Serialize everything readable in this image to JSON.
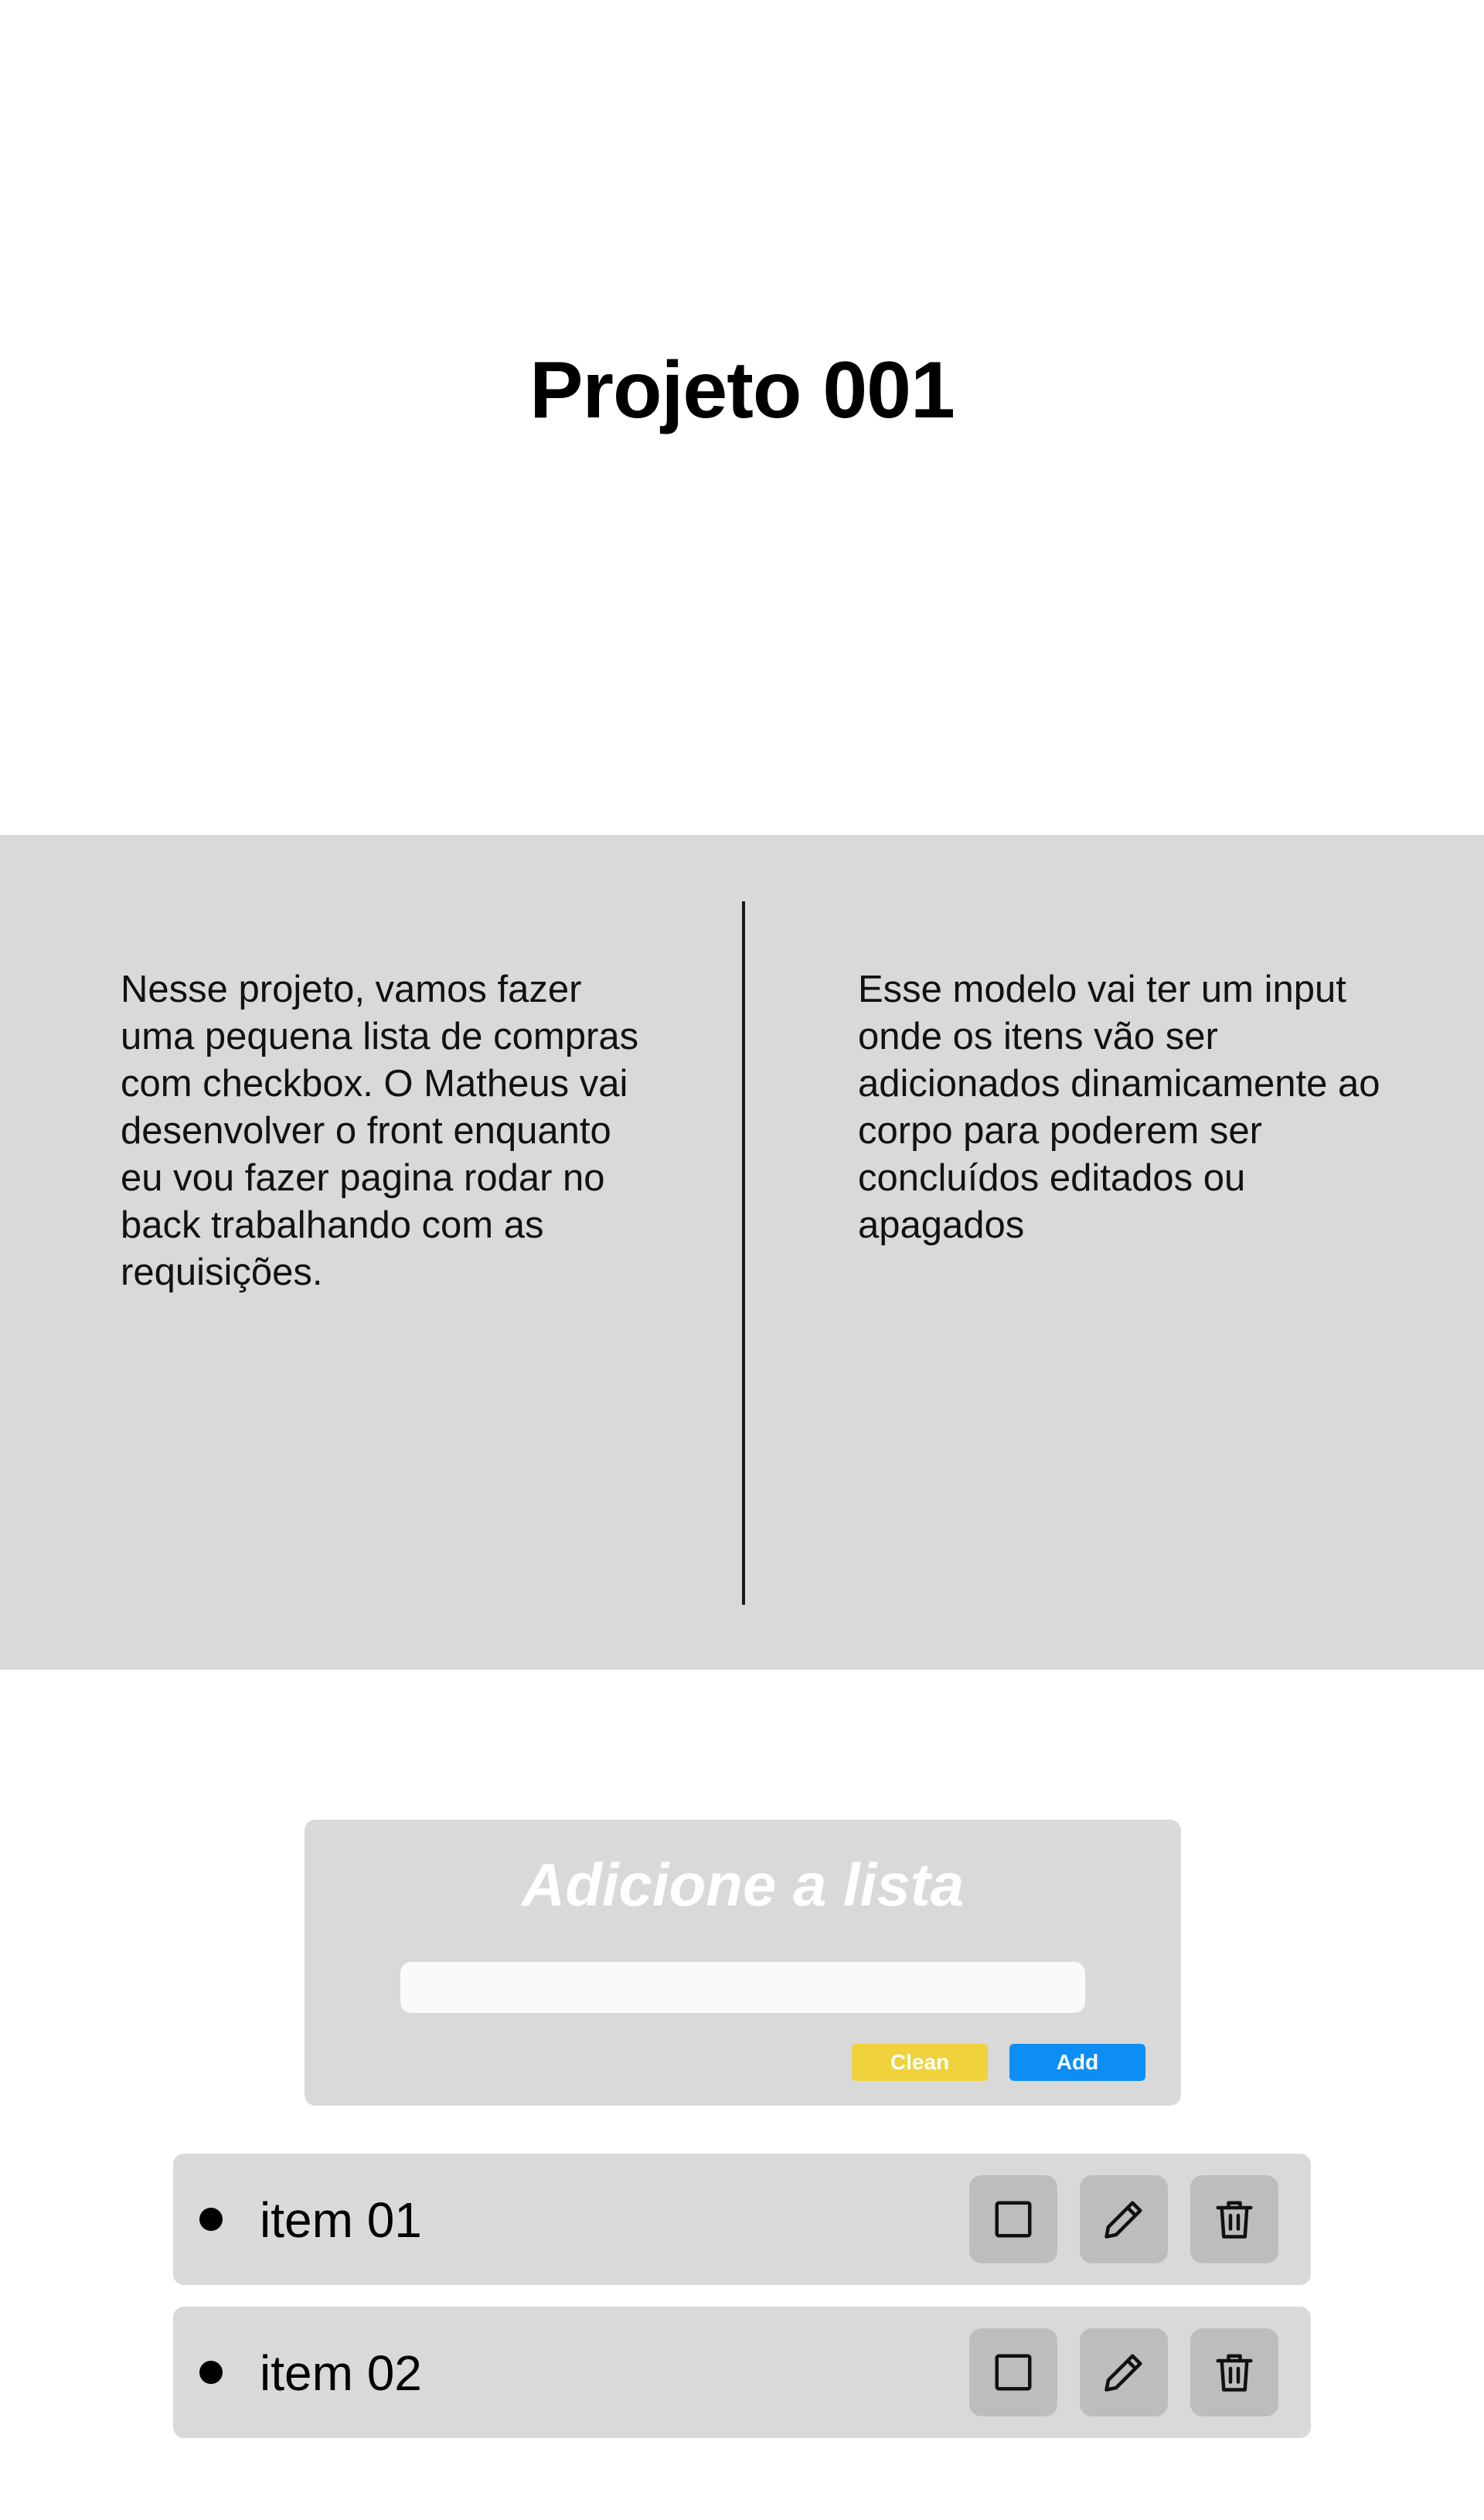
{
  "header": {
    "title": "Projeto 001"
  },
  "info": {
    "left_text": "Nesse projeto, vamos fazer uma pequena lista de compras com checkbox. O Matheus vai desenvolver o front enquanto eu vou fazer pagina rodar no back trabalhando com as requisições.",
    "right_text": "Esse modelo vai ter um input onde os itens vão ser adicionados dinamicamente  ao corpo para poderem ser concluídos editados ou apagados"
  },
  "add_card": {
    "title": "Adicione a lista",
    "input_value": "",
    "input_placeholder": "",
    "clean_label": "Clean",
    "add_label": "Add"
  },
  "colors": {
    "band_background": "#d9d9d9",
    "clean_button": "#f0d23c",
    "add_button": "#0d8ef5",
    "action_button": "#bdbdbd"
  },
  "items": [
    {
      "label": "item 01",
      "icons": [
        "square-checkbox-icon",
        "pencil-icon",
        "trash-icon"
      ]
    },
    {
      "label": "item 02",
      "icons": [
        "square-checkbox-icon",
        "pencil-icon",
        "trash-icon"
      ]
    }
  ]
}
